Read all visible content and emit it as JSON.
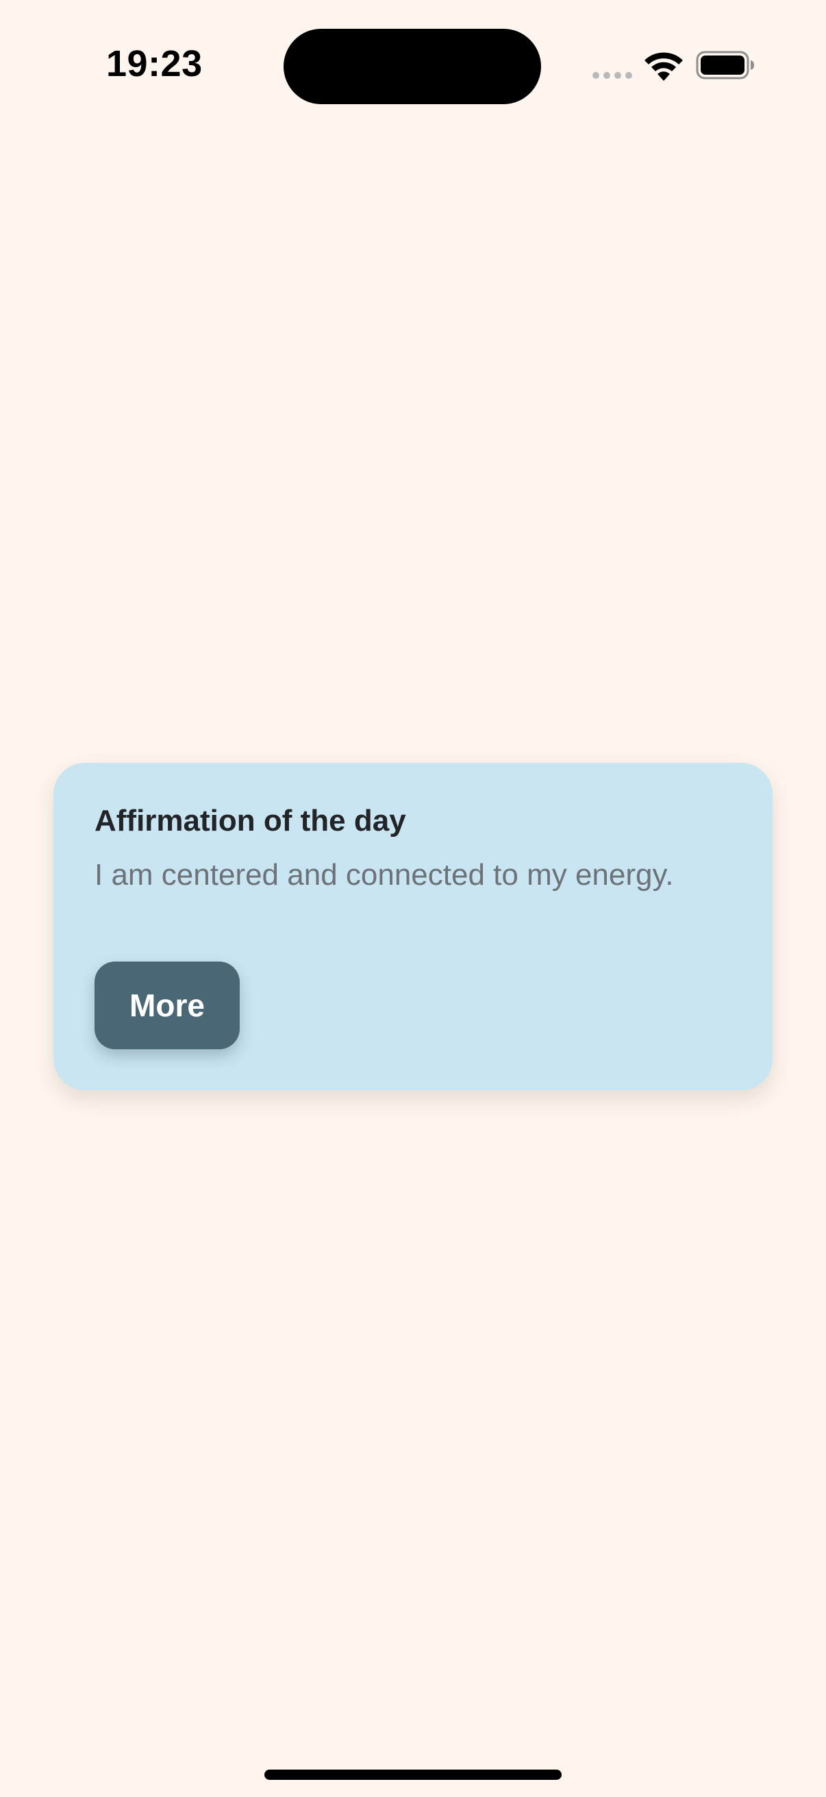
{
  "status_bar": {
    "time": "19:23",
    "icons": [
      "signal-dots-icon",
      "wifi-icon",
      "battery-icon"
    ]
  },
  "card": {
    "title": "Affirmation of the day",
    "text": "I am centered and connected to my energy.",
    "button_label": "More"
  },
  "colors": {
    "background": "#fdf5ee",
    "card": "#c8e5f1",
    "button": "#4a6776",
    "title": "#222427",
    "body_text": "#6d7278"
  }
}
